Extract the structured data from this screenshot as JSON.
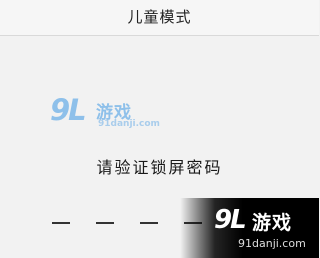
{
  "nav": {
    "title": "儿童模式"
  },
  "prompt": {
    "text": "请验证锁屏密码"
  },
  "pin": {
    "slots": 4,
    "filled": 0
  },
  "watermark": {
    "logo": "9L",
    "brand": "游戏",
    "url": "91danji.com",
    "color_primary": "#8ec0ea"
  }
}
